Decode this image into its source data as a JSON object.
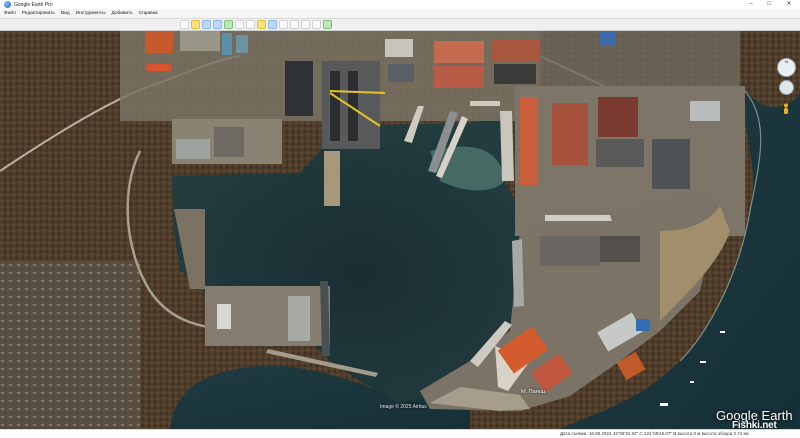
{
  "window": {
    "title": "Google Earth Pro",
    "controls": {
      "minimize": "–",
      "maximize": "□",
      "close": "✕"
    }
  },
  "menu": {
    "items": [
      "Файл",
      "Редактировать",
      "Вид",
      "Инструменты",
      "Добавить",
      "Справка"
    ]
  },
  "toolbar": {
    "buttons": [
      "sidebar",
      "placemark",
      "polygon",
      "path",
      "overlay",
      "tour",
      "history",
      "sun",
      "planets",
      "ruler",
      "email",
      "print",
      "save-image",
      "maps"
    ]
  },
  "map": {
    "imagery_credit": "Image © 2025 Airbus",
    "place_label": "М. Пагеш",
    "brand": "Google Earth",
    "watermark": "Fishki.net",
    "colors": {
      "water": "#1d3a3e",
      "land": "#4a3b2b",
      "industrial": "#8a8272",
      "roof_red": "#c4532e",
      "foam": "#8fb3a0"
    }
  },
  "status": {
    "left": "",
    "text": "Дата съемки: 16.09.2024  43°06'31.92\" С  131°59'46.07\" В  высота 0 м  высота обзора 2.74 км"
  },
  "navigation": {
    "north": "N"
  }
}
